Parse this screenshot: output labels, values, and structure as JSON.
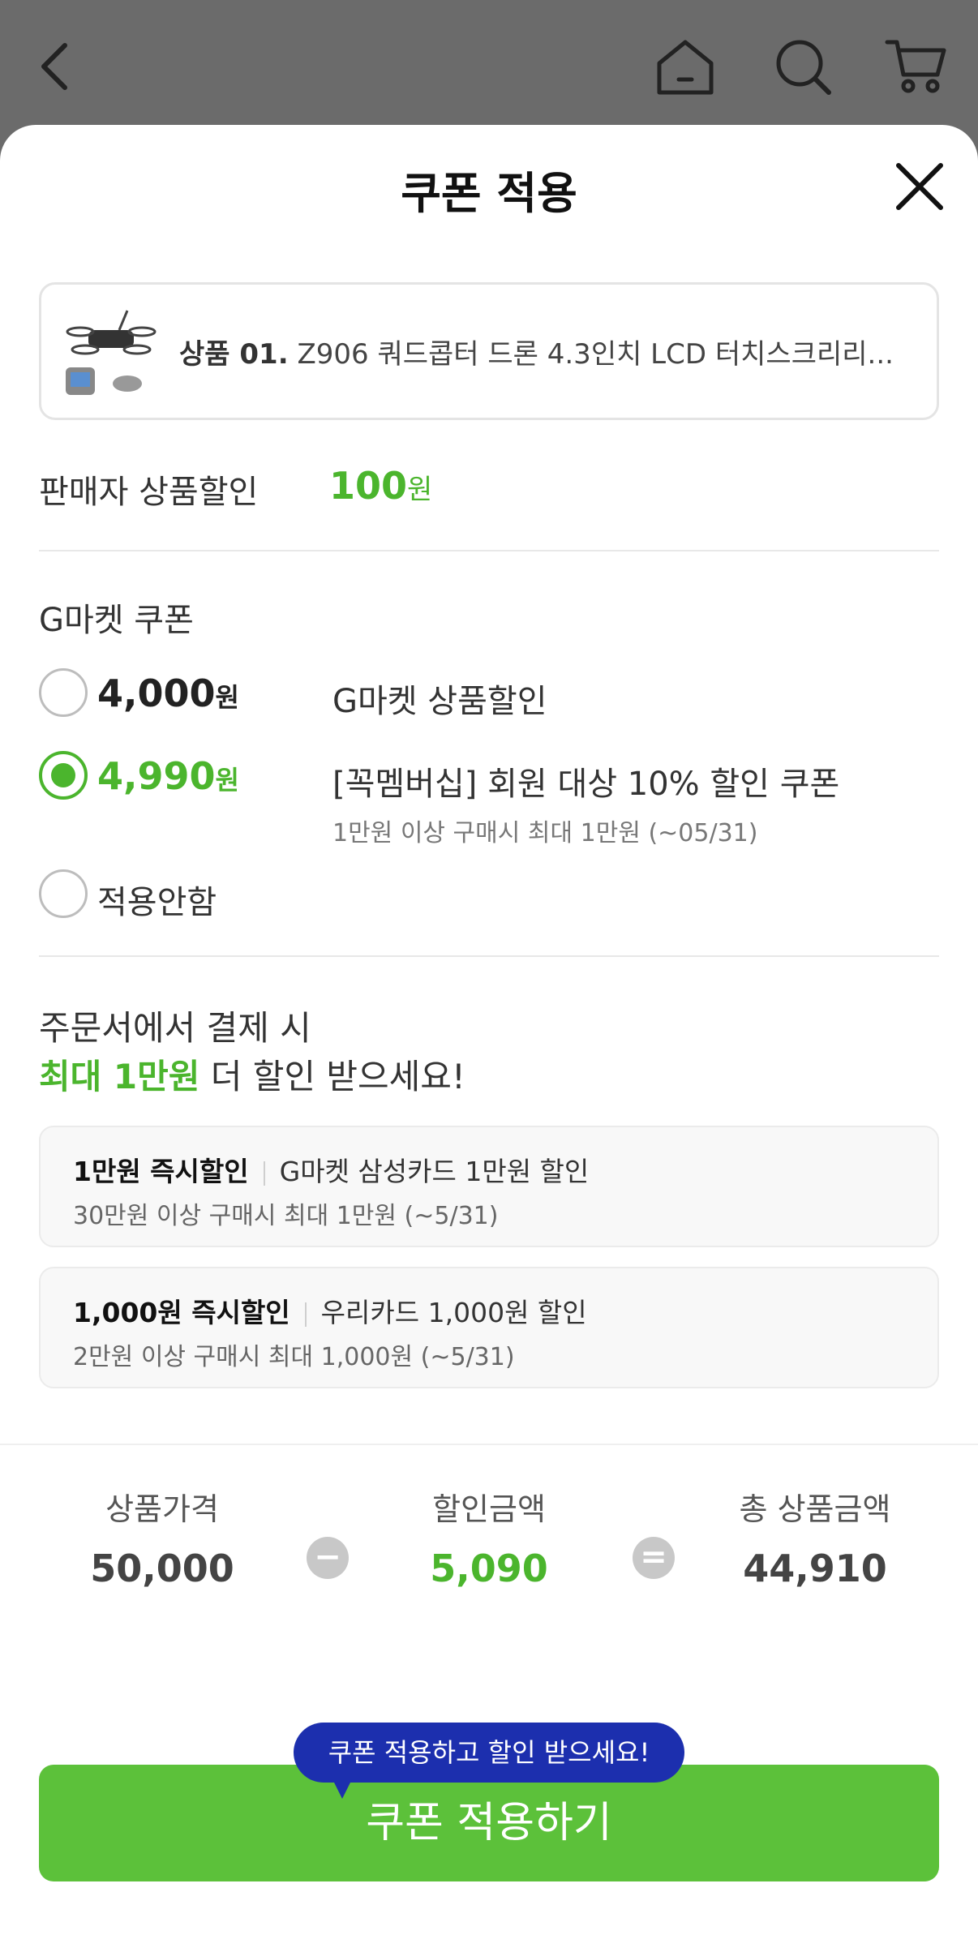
{
  "nav": {
    "back_icon": "chevron-left-icon",
    "home_icon": "home-icon",
    "search_icon": "search-icon",
    "cart_icon": "cart-icon"
  },
  "sheet": {
    "title": "쿠폰 적용",
    "close_icon": "close-icon"
  },
  "product": {
    "index_label": "상품 01.",
    "name": "Z906 쿼드콥터 드론 4.3인치 LCD 터치스크리리..."
  },
  "seller_discount": {
    "label": "판매자 상품할인",
    "amount": "100",
    "unit": "원"
  },
  "gmarket_coupon": {
    "title": "G마켓 쿠폰",
    "options": [
      {
        "amount": "4,000",
        "unit": "원",
        "name": "G마켓 상품할인",
        "sub": "",
        "selected": false
      },
      {
        "amount": "4,990",
        "unit": "원",
        "name": "[꼭멤버십] 회원 대상 10% 할인 쿠폰",
        "sub": "1만원 이상 구매시 최대 1만원 (~05/31)",
        "selected": true
      }
    ],
    "none_label": "적용안함"
  },
  "promo": {
    "line1": "주문서에서 결제 시",
    "line2_highlight": "최대 1만원",
    "line2_rest": " 더 할인 받으세요!"
  },
  "card_offers": [
    {
      "title": "1만원 즉시할인",
      "desc": "G마켓 삼성카드 1만원 할인",
      "sub": "30만원 이상 구매시 최대 1만원 (~5/31)"
    },
    {
      "title": "1,000원 즉시할인",
      "desc": "우리카드 1,000원 할인",
      "sub": "2만원 이상 구매시 최대 1,000원 (~5/31)"
    }
  ],
  "summary": {
    "price_label": "상품가격",
    "price_value": "50,000",
    "minus": "−",
    "discount_label": "할인금액",
    "discount_value": "5,090",
    "equals": "=",
    "total_label": "총 상품금액",
    "total_value": "44,910"
  },
  "tooltip": "쿠폰 적용하고 할인 받으세요!",
  "apply_button": "쿠폰 적용하기",
  "colors": {
    "accent_green": "#4bb52d",
    "button_green": "#5cc13a",
    "tooltip_blue": "#1c2fae"
  }
}
